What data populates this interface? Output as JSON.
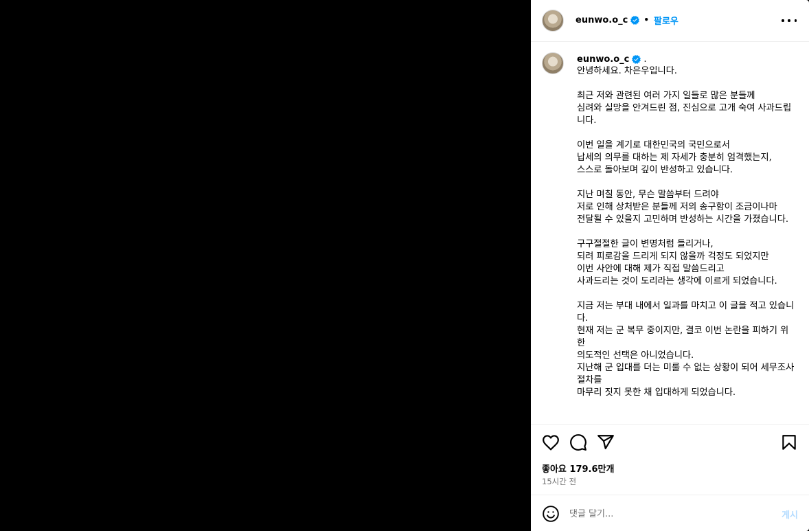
{
  "colors": {
    "accent": "#0095f6",
    "verified": "#0095f6",
    "muted": "#737373",
    "post_disabled": "#b3dbff",
    "media_bg": "#000000"
  },
  "header": {
    "username": "eunwo.o_c",
    "separator": "•",
    "follow_label": "팔로우",
    "more_icon": "more-horizontal-icon"
  },
  "caption": {
    "username": "eunwo.o_c",
    "period": ".",
    "text": "안녕하세요. 차은우입니다.\n\n최근 저와 관련된 여러 가지 일들로 많은 분들께\n심려와 실망을 안겨드린 점, 진심으로 고개 숙여 사과드립니다.\n\n이번 일을 계기로 대한민국의 국민으로서\n납세의 의무를 대하는 제 자세가 충분히 엄격했는지,\n스스로 돌아보며 깊이 반성하고 있습니다.\n\n지난 며칠 동안, 무슨 말씀부터 드려야\n저로 인해 상처받은 분들께 저의 송구함이 조금이나마\n전달될 수 있을지 고민하며 반성하는 시간을 가졌습니다.\n\n구구절절한 글이 변명처럼 들리거나,\n되려 피로감을 드리게 되지 않을까 걱정도 되었지만\n이번 사안에 대해 제가 직접 말씀드리고\n사과드리는 것이 도리라는 생각에 이르게 되었습니다.\n\n지금 저는 부대 내에서 일과를 마치고 이 글을 적고 있습니다.\n현재 저는 군 복무 중이지만, 결코 이번 논란을 피하기 위한\n의도적인 선택은 아니었습니다.\n지난해 군 입대를 더는 미룰 수 없는 상황이 되어 세무조사 절차를\n마무리 짓지 못한 채 입대하게 되었습니다."
  },
  "actions": {
    "like_icon": "heart-icon",
    "comment_icon": "comment-icon",
    "share_icon": "send-icon",
    "save_icon": "bookmark-icon",
    "likes_text": "좋아요 179.6만개",
    "time_text": "15시간 전"
  },
  "comment": {
    "emoji_icon": "emoji-icon",
    "placeholder": "댓글 달기...",
    "post_label": "게시"
  }
}
